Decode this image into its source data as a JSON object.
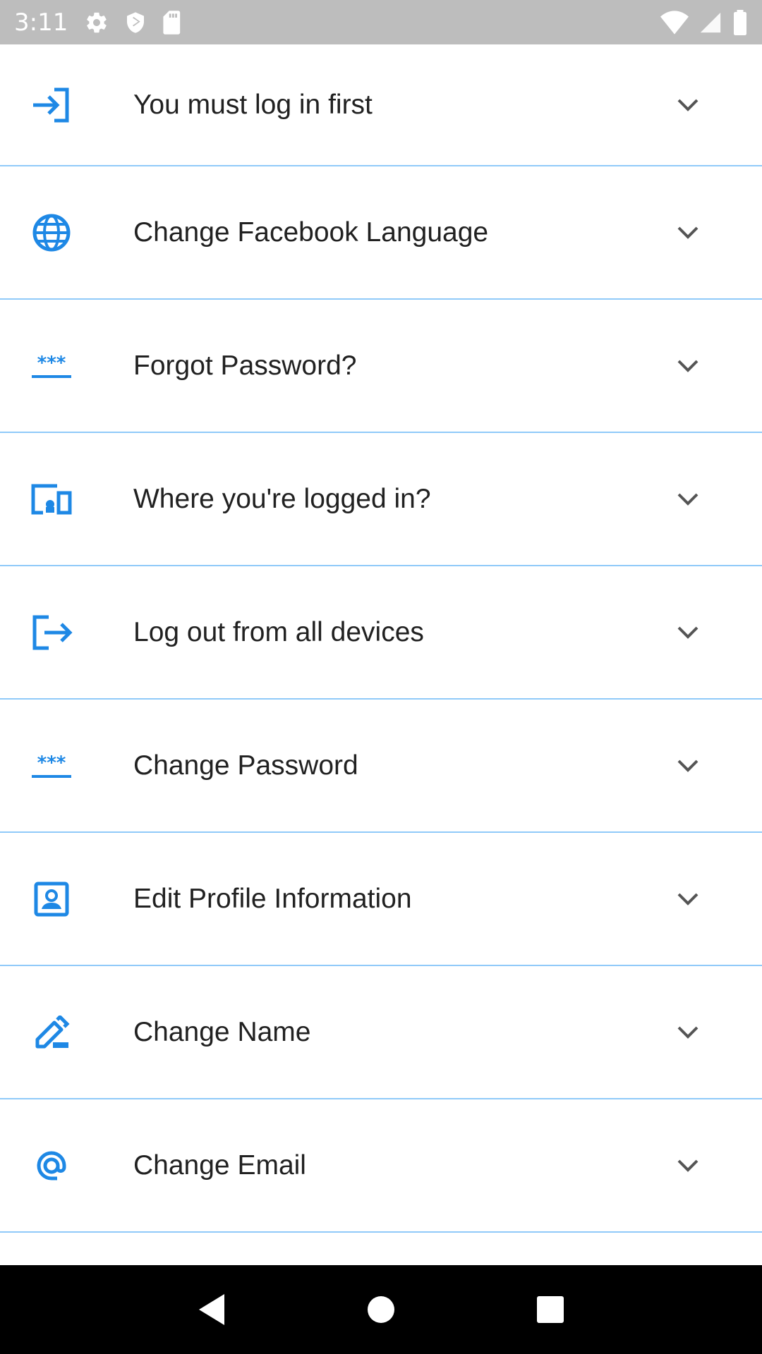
{
  "status_bar": {
    "time": "3:11",
    "left_icons": [
      "gear-icon",
      "shield-icon",
      "sd-card-icon"
    ],
    "right_icons": [
      "wifi-icon",
      "signal-icon",
      "battery-icon"
    ]
  },
  "colors": {
    "accent": "#1e88e5",
    "divider": "#90caf9",
    "text": "#212121",
    "status_bar": "#bdbdbd",
    "nav_bar": "#000000"
  },
  "items": [
    {
      "label": "You must log in first",
      "icon": "login-icon"
    },
    {
      "label": "Change Facebook Language",
      "icon": "globe-icon"
    },
    {
      "label": "Forgot Password?",
      "icon": "password-icon"
    },
    {
      "label": "Where you're logged in?",
      "icon": "devices-icon"
    },
    {
      "label": "Log out from all devices",
      "icon": "logout-icon"
    },
    {
      "label": "Change Password",
      "icon": "password-icon"
    },
    {
      "label": "Edit Profile Information",
      "icon": "contact-icon"
    },
    {
      "label": "Change Name",
      "icon": "edit-icon"
    },
    {
      "label": "Change Email",
      "icon": "at-icon"
    }
  ],
  "nav_bar": {
    "buttons": [
      "back-icon",
      "home-icon",
      "recents-icon"
    ]
  }
}
